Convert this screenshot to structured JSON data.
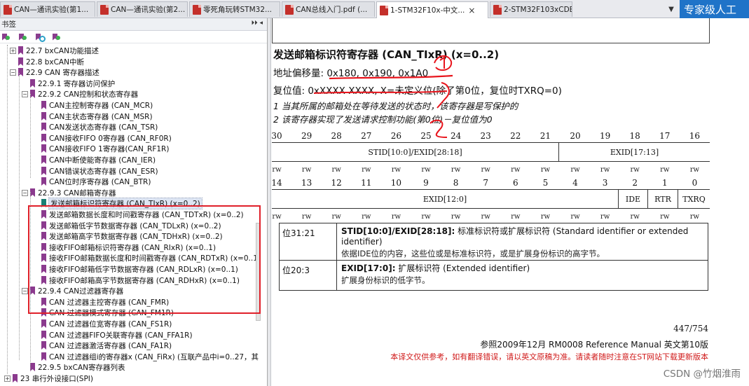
{
  "tabs": [
    {
      "label": "CAN—通讯实验(第1...",
      "icon": "pdf-icon",
      "active": false
    },
    {
      "label": "CAN—通讯实验(第2...",
      "icon": "pdf-icon",
      "active": false
    },
    {
      "label": "零死角玩转STM32...",
      "icon": "pdf-icon",
      "active": false
    },
    {
      "label": "CAN总线入门.pdf (...",
      "icon": "pdf-icon",
      "active": false
    },
    {
      "label": "1-STM32F10x-中文...",
      "icon": "pdf-icon",
      "active": true
    },
    {
      "label": "2-STM32F103xCDE...",
      "icon": "pdf-icon",
      "active": false
    }
  ],
  "tab_close": "×",
  "tab_overflow": "▼",
  "brand_text": "专家级人工",
  "sidebar": {
    "header": "书签",
    "header_controls": "⏵⏵ ◂",
    "tree": [
      {
        "label": "22.7 bxCAN功能描述",
        "level": 1,
        "expander": "+"
      },
      {
        "label": "22.8 bxCAN中断",
        "level": 1,
        "expander": ""
      },
      {
        "label": "22.9 CAN 寄存器描述",
        "level": 1,
        "expander": "−"
      },
      {
        "label": "22.9.1 寄存器访问保护",
        "level": 2,
        "expander": ""
      },
      {
        "label": "22.9.2 CAN控制和状态寄存器",
        "level": 2,
        "expander": "−"
      },
      {
        "label": "CAN主控制寄存器 (CAN_MCR)",
        "level": 3,
        "expander": ""
      },
      {
        "label": "CAN主状态寄存器 (CAN_MSR)",
        "level": 3,
        "expander": ""
      },
      {
        "label": "CAN发送状态寄存器 (CAN_TSR)",
        "level": 3,
        "expander": ""
      },
      {
        "label": "CAN接收FIFO 0寄存器 (CAN_RF0R)",
        "level": 3,
        "expander": ""
      },
      {
        "label": "CAN接收FIFO 1寄存器(CAN_RF1R)",
        "level": 3,
        "expander": ""
      },
      {
        "label": "CAN中断使能寄存器 (CAN_IER)",
        "level": 3,
        "expander": ""
      },
      {
        "label": "CAN错误状态寄存器 (CAN_ESR)",
        "level": 3,
        "expander": ""
      },
      {
        "label": "CAN位时序寄存器 (CAN_BTR)",
        "level": 3,
        "expander": ""
      },
      {
        "label": "22.9.3 CAN邮箱寄存器",
        "level": 2,
        "expander": "−"
      },
      {
        "label": "发送邮箱标识符寄存器 (CAN_TIxR) (x=0..2)",
        "level": 3,
        "expander": "",
        "selected": true
      },
      {
        "label": "发送邮箱数据长度和时间戳寄存器 (CAN_TDTxR) (x=0..2)",
        "level": 3,
        "expander": ""
      },
      {
        "label": "发送邮箱低字节数据寄存器 (CAN_TDLxR) (x=0..2)",
        "level": 3,
        "expander": ""
      },
      {
        "label": "发送邮箱高字节数据寄存器 (CAN_TDHxR) (x=0..2)",
        "level": 3,
        "expander": ""
      },
      {
        "label": "接收FIFO邮箱标识符寄存器 (CAN_RIxR) (x=0..1)",
        "level": 3,
        "expander": ""
      },
      {
        "label": "接收FIFO邮箱数据长度和时间戳寄存器 (CAN_RDTxR) (x=0..1)",
        "level": 3,
        "expander": ""
      },
      {
        "label": "接收FIFO邮箱低字节数据寄存器 (CAN_RDLxR) (x=0..1)",
        "level": 3,
        "expander": ""
      },
      {
        "label": "接收FIFO邮箱高字节数据寄存器 (CAN_RDHxR) (x=0..1)",
        "level": 3,
        "expander": ""
      },
      {
        "label": "22.9.4 CAN过滤器寄存器",
        "level": 2,
        "expander": "−"
      },
      {
        "label": "CAN 过滤器主控寄存器 (CAN_FMR)",
        "level": 3,
        "expander": ""
      },
      {
        "label": "CAN 过滤器模式寄存器 (CAN_FM1R)",
        "level": 3,
        "expander": ""
      },
      {
        "label": "CAN 过滤器位宽寄存器 (CAN_FS1R)",
        "level": 3,
        "expander": ""
      },
      {
        "label": "CAN 过滤器FIFO关联寄存器 (CAN_FFA1R)",
        "level": 3,
        "expander": ""
      },
      {
        "label": "CAN 过滤器激活寄存器 (CAN_FA1R)",
        "level": 3,
        "expander": ""
      },
      {
        "label": "CAN 过滤器组i的寄存器x (CAN_FiRx) (互联产品中i=0..27，其",
        "level": 3,
        "expander": ""
      },
      {
        "label": "22.9.5 bxCAN寄存器列表",
        "level": 2,
        "expander": ""
      },
      {
        "label": "23 串行外设接口(SPI)",
        "level": 0,
        "expander": "+"
      }
    ]
  },
  "document": {
    "title": "发送邮箱标识符寄存器 (CAN_TIxR) (x=0..2)",
    "address_offset": "地址偏移量: 0x180, 0x190, 0x1A0",
    "reset_value": "复位值: 0xXXXX XXXX, X=未定义位(除了第0位，复位时TXRQ=0)",
    "notes": [
      "1 当其所属的邮箱处在等待发送的状态时，该寄存器是写保护的",
      "2 该寄存器实现了发送请求控制功能(第0位)－复位值为0"
    ],
    "bits_high": [
      "30",
      "29",
      "28",
      "27",
      "26",
      "25",
      "24",
      "23",
      "22",
      "21",
      "20",
      "19",
      "18",
      "17",
      "16"
    ],
    "bits_low": [
      "14",
      "13",
      "12",
      "11",
      "10",
      "9",
      "8",
      "7",
      "6",
      "5",
      "4",
      "3",
      "2",
      "1",
      "0"
    ],
    "rw_label": "rw",
    "field_stid": "STID[10:0]/EXID[28:18]",
    "field_exid_high": "EXID[17:13]",
    "field_exid_low": "EXID[12:0]",
    "field_ide": "IDE",
    "field_rtr": "RTR",
    "field_txrq": "TXRQ",
    "field_table": [
      {
        "bits": "位31:21",
        "name": "STID[10:0]/EXID[28:18]:",
        "desc": " 标准标识符或扩展标识符 (Standard identifier or extended identifier)",
        "sub": "依据IDE位的内容，这些位或是标准标识符，或是扩展身份标识的高字节。"
      },
      {
        "bits": "位20:3",
        "name": "EXID[17:0]:",
        "desc": " 扩展标识符 (Extended identifier)",
        "sub": "扩展身份标识的低字节。"
      }
    ],
    "page_number": "447/754",
    "reference": "参照2009年12月 RM0008 Reference Manual 英文第10版",
    "disclaimer": "本译文仅供参考，如有翻译错误，请以英文原稿为准。请读者随时注意在ST网站下载更新版本",
    "watermark": "CSDN @竹烟淮雨"
  },
  "colors": {
    "highlight_box": "#e0202a",
    "annotation_ink": "#e8141c",
    "bookmark": "#8b3a8e",
    "bookmark_selected": "#1a7f74",
    "brand": "#1f73c8"
  }
}
